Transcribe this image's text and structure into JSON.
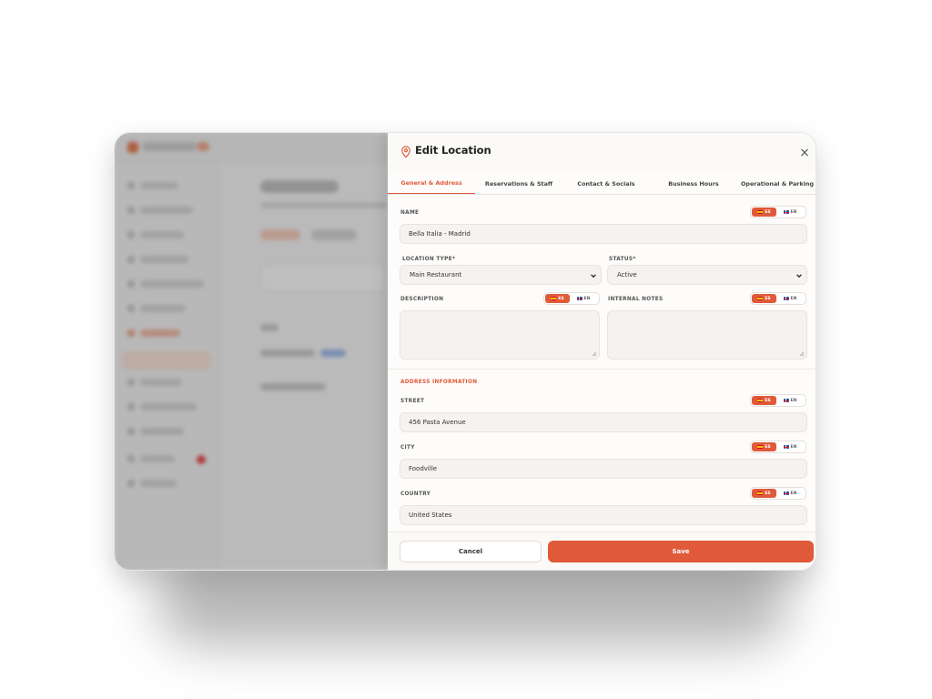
{
  "drawer": {
    "title": "Edit Location",
    "close_symbol": "×"
  },
  "tabs": [
    {
      "label": "General & Address",
      "active": true
    },
    {
      "label": "Reservations & Staff",
      "active": false
    },
    {
      "label": "Contact & Socials",
      "active": false
    },
    {
      "label": "Business Hours",
      "active": false
    },
    {
      "label": "Operational & Parking",
      "active": false
    }
  ],
  "languages": {
    "es": "ES",
    "en": "EN"
  },
  "form": {
    "name": {
      "label": "NAME",
      "value": "Bella Italia - Madrid"
    },
    "location_type": {
      "label": "LOCATION TYPE*",
      "value": "Main Restaurant"
    },
    "status": {
      "label": "STATUS*",
      "value": "Active"
    },
    "description": {
      "label": "DESCRIPTION",
      "value": ""
    },
    "internal_notes": {
      "label": "INTERNAL NOTES",
      "value": ""
    },
    "address_section": "ADDRESS INFORMATION",
    "street": {
      "label": "STREET",
      "value": "456 Pasta Avenue"
    },
    "city": {
      "label": "CITY",
      "value": "Foodville"
    },
    "country": {
      "label": "COUNTRY",
      "value": "United States"
    }
  },
  "footer": {
    "cancel_label": "Cancel",
    "save_label": "Save"
  },
  "colors": {
    "accent": "#e05a3a",
    "field_bg": "#f5f3ef"
  },
  "icons": [
    "location-pin-icon",
    "close-icon",
    "chevron-down-icon",
    "es-flag-icon",
    "uk-flag-icon",
    "resize-grip-icon"
  ]
}
